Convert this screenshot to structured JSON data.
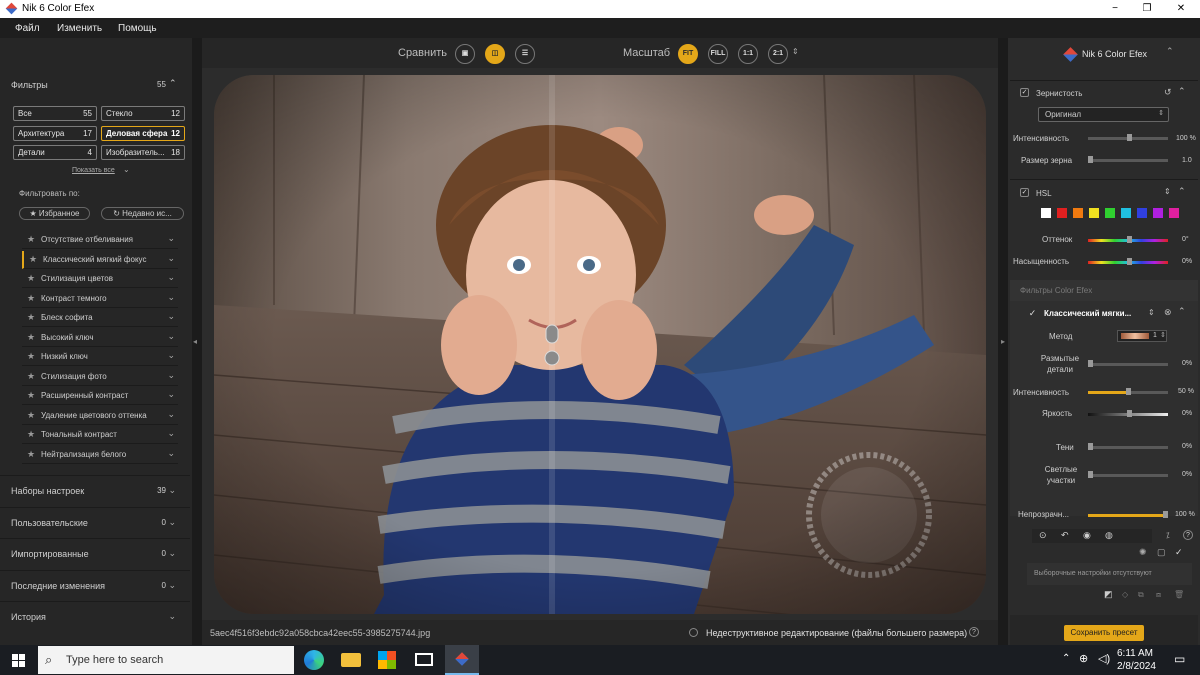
{
  "window": {
    "title": "Nik 6 Color Efex",
    "controls": [
      "−",
      "❐",
      "✕"
    ]
  },
  "menu": [
    "Файл",
    "Изменить",
    "Помощь"
  ],
  "left": {
    "filters_title": "Фильтры",
    "filters_count": "55",
    "categories": [
      {
        "label": "Все",
        "count": "55"
      },
      {
        "label": "Стекло",
        "count": "12"
      },
      {
        "label": "Архитектура",
        "count": "17"
      },
      {
        "label": "Деловая сфера",
        "count": "12"
      },
      {
        "label": "Детали",
        "count": "4"
      },
      {
        "label": "Изобразитель...",
        "count": "18"
      }
    ],
    "show_all": "Показать все",
    "filter_by": "Фильтровать по:",
    "favorites": "Избранное",
    "recent": "Недавно ис...",
    "filters": [
      "Отсутствие отбеливания",
      "Классический мягкий фокус",
      "Стилизация цветов",
      "Контраст темного",
      "Блеск софита",
      "Высокий ключ",
      "Низкий ключ",
      "Стилизация фото",
      "Расширенный контраст",
      "Удаление цветового оттенка",
      "Тональный контраст",
      "Нейтрализация белого"
    ],
    "groups": [
      {
        "label": "Наборы настроек",
        "count": "39"
      },
      {
        "label": "Пользовательские",
        "count": "0"
      },
      {
        "label": "Импортированные",
        "count": "0"
      },
      {
        "label": "Последние изменения",
        "count": "0"
      },
      {
        "label": "История",
        "count": ""
      }
    ]
  },
  "toolbar": {
    "compare": "Сравнить",
    "scale": "Масштаб",
    "fit": "FIT",
    "fill": "FILL",
    "one": "1:1",
    "two": "2:1"
  },
  "status": {
    "filename": "5aec4f516f3ebdc92a058cbca42eec55-3985275744.jpg",
    "nondestructive": "Недеструктивное редактирование (файлы большего размера)"
  },
  "right": {
    "brand": "Nik 6 Color Efex",
    "grain": "Зернистость",
    "grain_mode": "Оригинал",
    "intensity": "Интенсивность",
    "intensity_val": "100 %",
    "grain_size": "Размер зерна",
    "grain_size_val": "1.0",
    "hsl": "HSL",
    "hue": "Оттенок",
    "hue_val": "0°",
    "saturation": "Насыщенность",
    "saturation_val": "0%",
    "swatches": [
      "#ffffff",
      "#e02020",
      "#f07a10",
      "#f0e020",
      "#30d030",
      "#20c0e0",
      "#3040e0",
      "#b020e0",
      "#e020a0"
    ],
    "section": "Фильтры Color Efex",
    "filter_name": "Классический мягки...",
    "method": "Метод",
    "method_val": "1",
    "blur": "Размытые детали",
    "blur_val": "0%",
    "fintensity": "Интенсивность",
    "fintensity_val": "50 %",
    "fintensity_level": 0.5,
    "brightness": "Яркость",
    "brightness_val": "0%",
    "shadows": "Тени",
    "shadows_val": "0%",
    "highlights": "Светлые участки",
    "highlights_val": "0%",
    "opacity": "Непрозрачн...",
    "opacity_val": "100 %",
    "opacity_level": 1.0,
    "no_presets": "Выборочные настройки отсутствуют",
    "save_preset": "Сохранить пресет"
  },
  "taskbar": {
    "search": "Type here to search",
    "time": "6:11 AM",
    "date": "2/8/2024"
  }
}
